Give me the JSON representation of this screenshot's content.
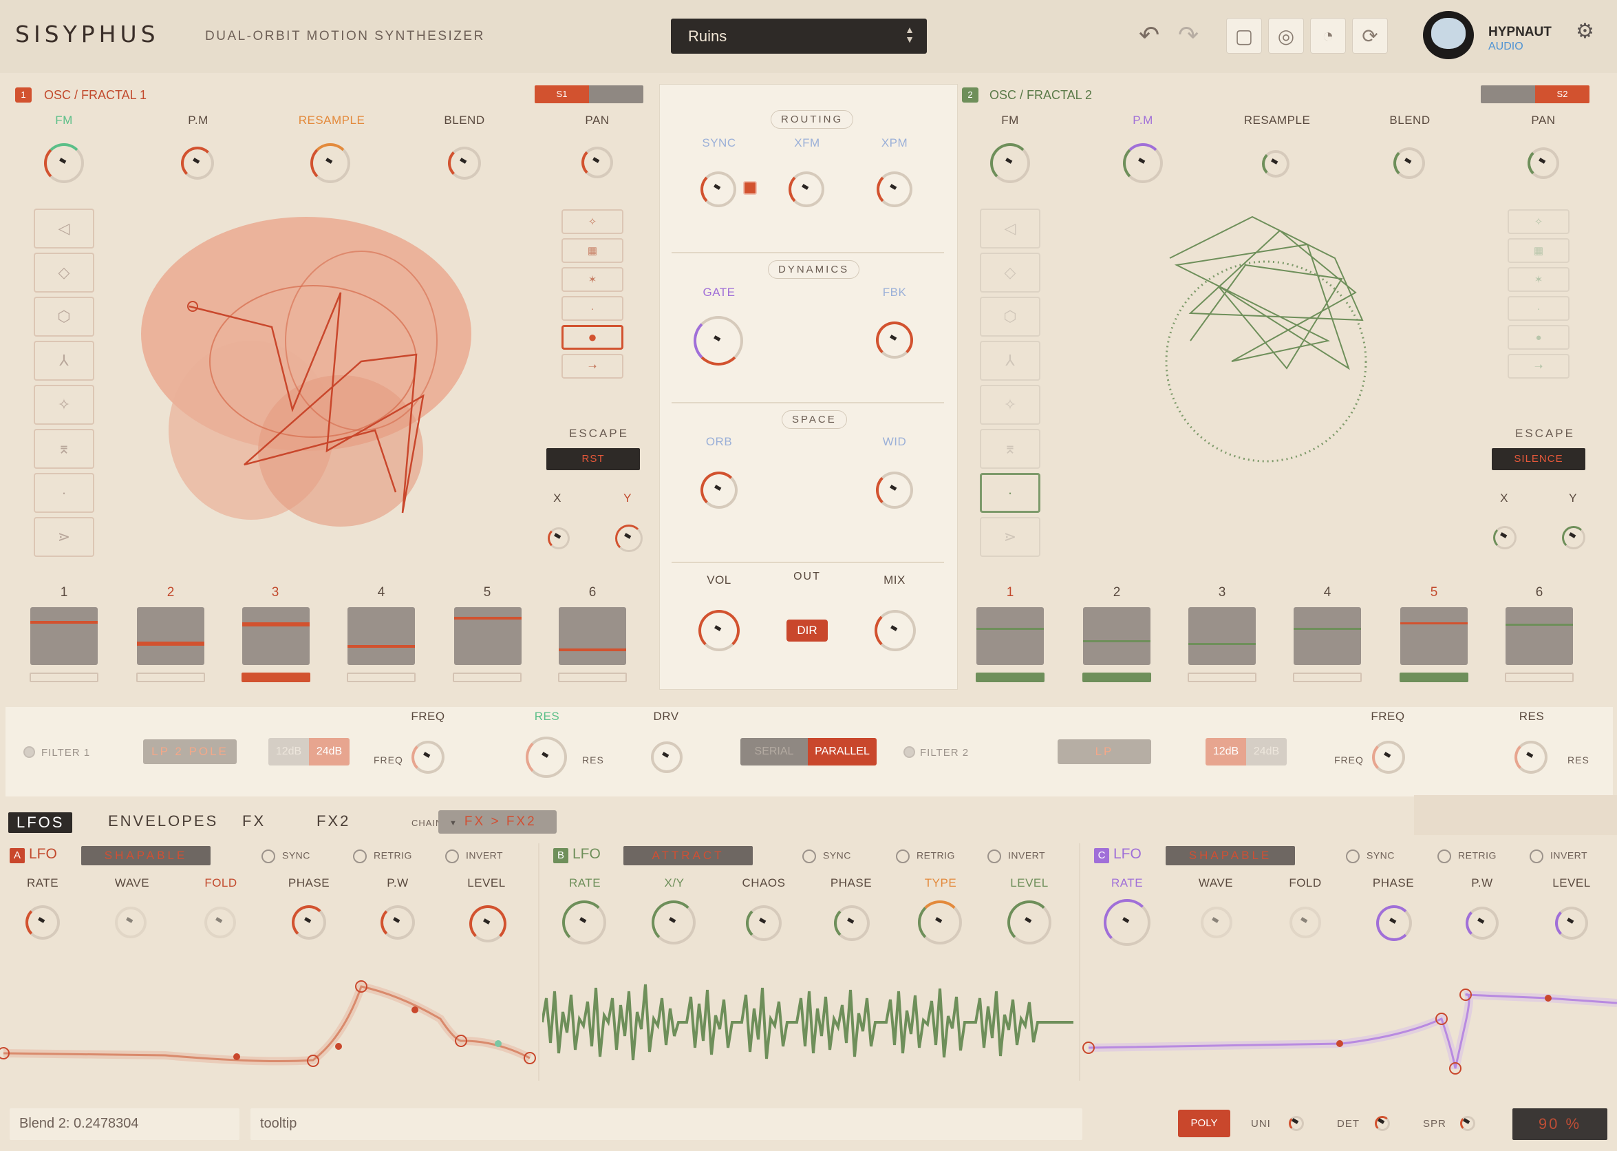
{
  "header": {
    "logo": "SISYPHUS",
    "tagline": "DUAL-ORBIT MOTION SYNTHESIZER",
    "preset": "Ruins",
    "brand_name": "HYPNAUT",
    "brand_sub": "AUDIO"
  },
  "osc1": {
    "num": "1",
    "title": "OSC / FRACTAL 1",
    "slot_label": "S1",
    "knob_labels": [
      "FM",
      "P.M",
      "RESAMPLE",
      "BLEND",
      "PAN"
    ],
    "escape_label": "ESCAPE",
    "escape_value": "RST",
    "xy_labels": [
      "X",
      "Y"
    ],
    "slots": [
      "1",
      "2",
      "3",
      "4",
      "5",
      "6"
    ]
  },
  "osc2": {
    "num": "2",
    "title": "OSC / FRACTAL 2",
    "slot_label": "S2",
    "knob_labels": [
      "FM",
      "P.M",
      "RESAMPLE",
      "BLEND",
      "PAN"
    ],
    "escape_label": "ESCAPE",
    "escape_value": "SILENCE",
    "xy_labels": [
      "X",
      "Y"
    ],
    "slots": [
      "1",
      "2",
      "3",
      "4",
      "5",
      "6"
    ]
  },
  "center": {
    "routing": "ROUTING",
    "routing_labels": [
      "SYNC",
      "XFM",
      "XPM"
    ],
    "dynamics": "DYNAMICS",
    "dynamics_labels": [
      "GATE",
      "FBK"
    ],
    "space": "SPACE",
    "space_labels": [
      "ORB",
      "WID"
    ],
    "vol": "VOL",
    "out": "OUT",
    "mix": "MIX",
    "dir": "DIR"
  },
  "filters": {
    "filter1": "FILTER 1",
    "filter1_type": "LP 2 POLE",
    "slope1_left": "12dB",
    "slope1_right": "24dB",
    "freq_title": "FREQ",
    "res_title": "RES",
    "drv_title": "DRV",
    "freq_small": "FREQ",
    "res_small": "RES",
    "serial": "SERIAL",
    "parallel": "PARALLEL",
    "filter2": "FILTER 2",
    "filter2_type": "LP",
    "slope2_left": "12dB",
    "slope2_right": "24dB",
    "freq2_title": "FREQ",
    "res2_title": "RES",
    "freq2_small": "FREQ",
    "res2_small": "RES"
  },
  "tabs": [
    "LFOS",
    "ENVELOPES",
    "FX",
    "FX2"
  ],
  "chain": {
    "label": "CHAIN",
    "value": "FX > FX2"
  },
  "lfo_a": {
    "letter": "A",
    "name": "LFO",
    "mode": "SHAPABLE",
    "opts": [
      "SYNC",
      "RETRIG",
      "INVERT"
    ],
    "params": [
      "RATE",
      "WAVE",
      "FOLD",
      "PHASE",
      "P.W",
      "LEVEL"
    ]
  },
  "lfo_b": {
    "letter": "B",
    "name": "LFO",
    "mode": "ATTRACT",
    "opts": [
      "SYNC",
      "RETRIG",
      "INVERT"
    ],
    "params": [
      "RATE",
      "X/Y",
      "CHAOS",
      "PHASE",
      "TYPE",
      "LEVEL"
    ]
  },
  "lfo_c": {
    "letter": "C",
    "name": "LFO",
    "mode": "SHAPABLE",
    "opts": [
      "SYNC",
      "RETRIG",
      "INVERT"
    ],
    "params": [
      "RATE",
      "WAVE",
      "FOLD",
      "PHASE",
      "P.W",
      "LEVEL"
    ]
  },
  "footer": {
    "value_readout": "Blend 2: 0.2478304",
    "tooltip": "tooltip",
    "poly": "POLY",
    "uni": "UNI",
    "det": "DET",
    "spr": "SPR",
    "zoom": "90 %"
  },
  "colors": {
    "accent_red": "#c9472c",
    "accent_green": "#6e8f5a",
    "accent_purple": "#a06fd8",
    "accent_orange": "#e38a3c",
    "dark": "#2e2a27"
  }
}
